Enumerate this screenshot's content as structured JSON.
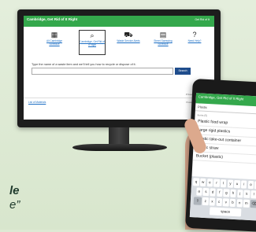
{
  "desktop": {
    "header_title": "Cambridge, Get Rid of It Right",
    "header_right": "Get Rid of It",
    "nav": [
      {
        "label": "All Cambridge Schedule",
        "icon": "calendar-icon"
      },
      {
        "label": "Cambridge, Get Rid of It Right",
        "icon": "magnifier-icon"
      },
      {
        "label": "Waste Service Alerts",
        "icon": "truck-icon"
      },
      {
        "label": "Street Sweeping Schedule",
        "icon": "sweeper-icon"
      },
      {
        "label": "Need Help?",
        "icon": "help-icon"
      }
    ],
    "prompt": "Type the name of a waste item and we'll tell you how to recycle or dispose of it.",
    "search_button": "Search",
    "footer_privacy": "Privacy · Terms of Use",
    "footer_link": "List of Materials",
    "footer_powered": "Powered by ReCollect"
  },
  "mobile": {
    "header_title": "Cambridge, Get Rid of It Right",
    "search_value": "Plastic",
    "subheading": "Items (5)",
    "results": [
      "Plastic food wrap",
      "Large rigid plastics",
      "Plastic take-out container",
      "Plastic straw",
      "Bucket (plastic)"
    ],
    "keyboard": {
      "row1": [
        "q",
        "w",
        "e",
        "r",
        "t",
        "y",
        "u",
        "i",
        "o",
        "p"
      ],
      "row2": [
        "a",
        "s",
        "d",
        "f",
        "g",
        "h",
        "j",
        "k",
        "l"
      ],
      "row3": [
        "z",
        "x",
        "c",
        "v",
        "b",
        "n",
        "m"
      ],
      "space": "space"
    }
  },
  "tagline": {
    "line1": "le",
    "line2": "e”"
  },
  "colors": {
    "brand_green": "#34a84c",
    "button_blue": "#1f4d8c",
    "link_blue": "#1d6fc4"
  }
}
